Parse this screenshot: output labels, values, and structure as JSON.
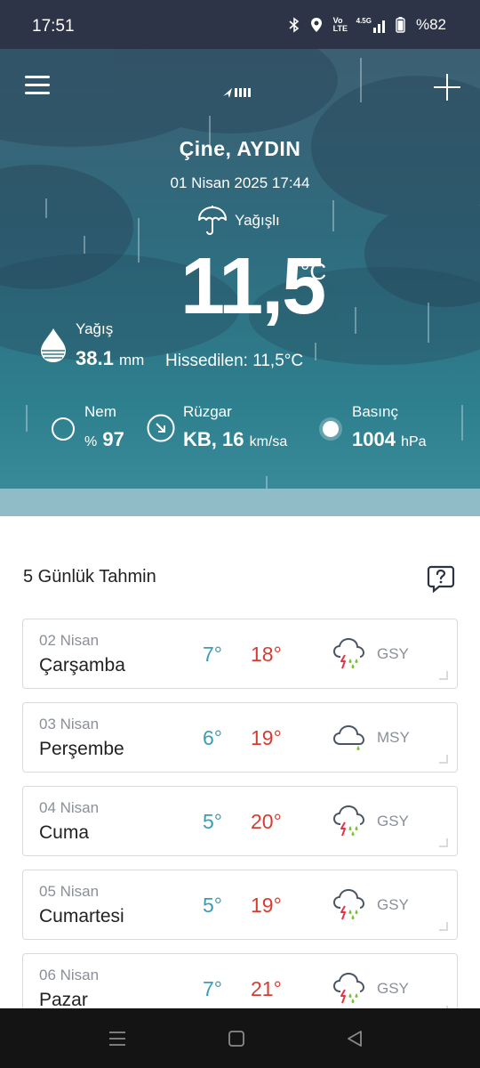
{
  "status_bar": {
    "time": "17:51",
    "battery": "%82",
    "network_volte": "Vo LTE",
    "network_5g": "4.5G"
  },
  "header": {
    "city": "Çine, AYDIN",
    "datetime": "01 Nisan 2025 17:44",
    "condition": "Yağışlı"
  },
  "current": {
    "temperature": "11,5",
    "temperature_unit": "°C",
    "feels_like": "Hissedilen: 11,5°C",
    "rain": {
      "label": "Yağış",
      "value": "38.1",
      "unit": "mm"
    },
    "humidity": {
      "label": "Nem",
      "prefix": "%",
      "value": "97"
    },
    "wind": {
      "label": "Rüzgar",
      "value": "KB, 16",
      "unit": "km/sa"
    },
    "pressure": {
      "label": "Basınç",
      "value": "1004",
      "unit": "hPa"
    }
  },
  "forecast": {
    "title": "5 Günlük Tahmin",
    "days": [
      {
        "date": "02 Nisan",
        "day": "Çarşamba",
        "min": "7°",
        "max": "18°",
        "code": "GSY",
        "icon": "thunder-rain-icon"
      },
      {
        "date": "03 Nisan",
        "day": "Perşembe",
        "min": "6°",
        "max": "19°",
        "code": "MSY",
        "icon": "light-rain-icon"
      },
      {
        "date": "04 Nisan",
        "day": "Cuma",
        "min": "5°",
        "max": "20°",
        "code": "GSY",
        "icon": "thunder-rain-icon"
      },
      {
        "date": "05 Nisan",
        "day": "Cumartesi",
        "min": "5°",
        "max": "19°",
        "code": "GSY",
        "icon": "thunder-rain-icon"
      },
      {
        "date": "06 Nisan",
        "day": "Pazar",
        "min": "7°",
        "max": "21°",
        "code": "GSY",
        "icon": "thunder-rain-icon"
      }
    ]
  },
  "colors": {
    "min_temp": "#3a9db5",
    "max_temp": "#d53d32",
    "hero_top": "#3d5f72",
    "hero_bottom": "#3c8e9c"
  }
}
